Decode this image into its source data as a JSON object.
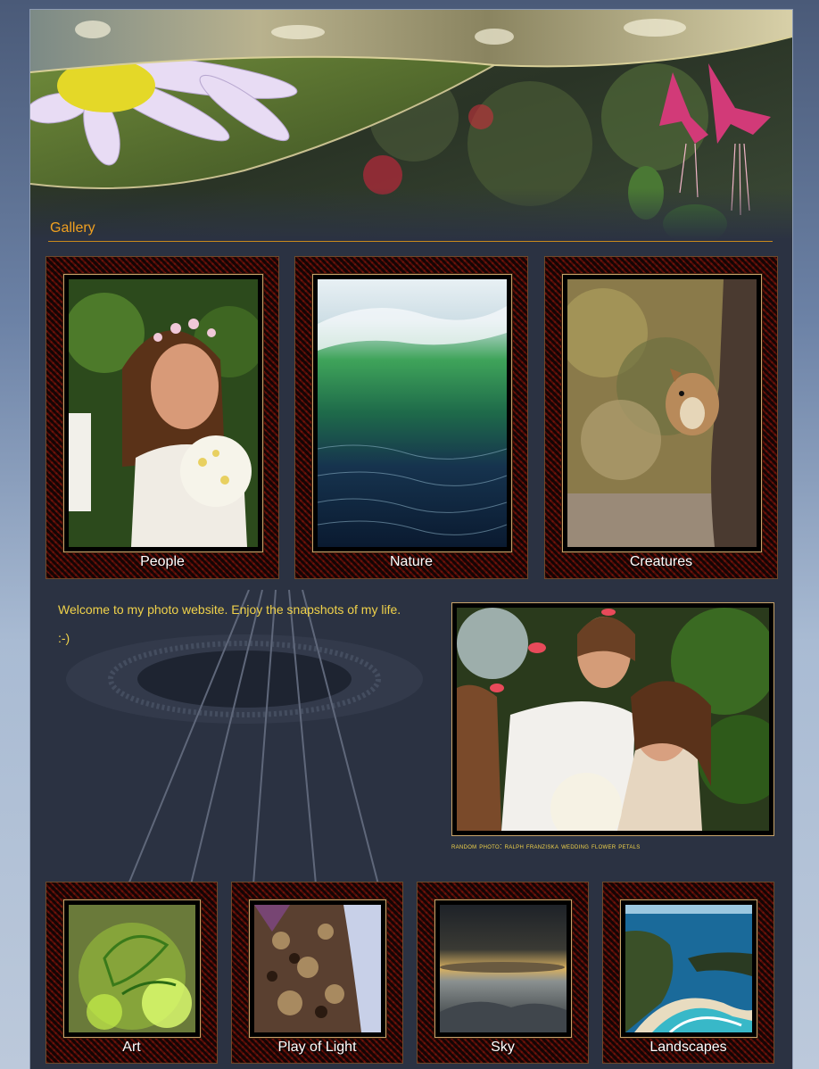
{
  "section": {
    "title": "Gallery"
  },
  "top_gallery": [
    {
      "label": "People"
    },
    {
      "label": "Nature"
    },
    {
      "label": "Creatures"
    }
  ],
  "welcome": {
    "text": "Welcome to my photo website. Enjoy the snapshots of my life.",
    "smiley": ":-)"
  },
  "random_photo": {
    "caption": "random photo: ralph franziska wedding flower petals"
  },
  "bottom_gallery": [
    {
      "label": "Art"
    },
    {
      "label": "Play of Light"
    },
    {
      "label": "Sky"
    },
    {
      "label": "Landscapes"
    }
  ],
  "colors": {
    "heading": "#f0a020",
    "body_text": "#f0d24a",
    "page_bg": "#2b3242",
    "frame_border": "#c8a46a"
  }
}
